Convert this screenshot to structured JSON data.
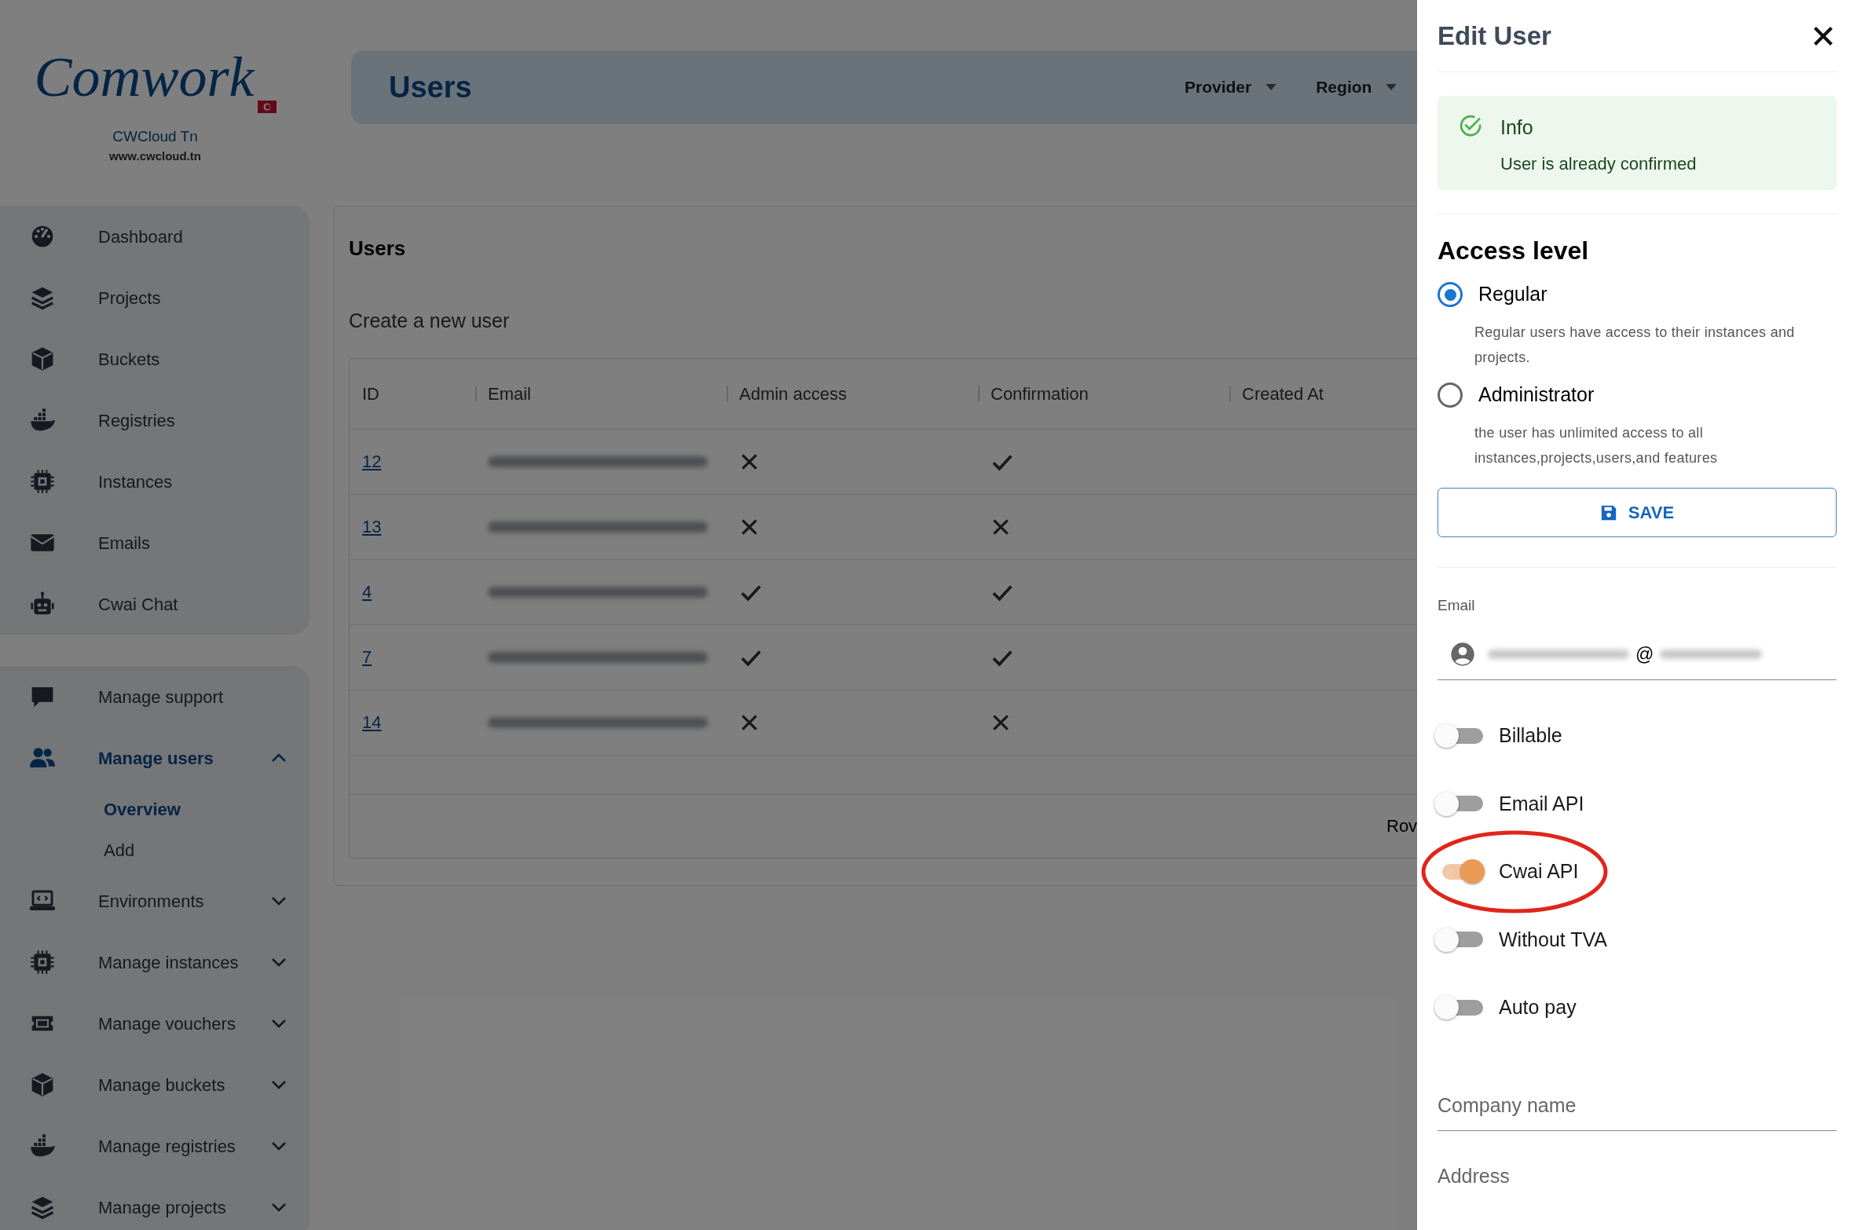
{
  "brand": {
    "logo": "Comwork",
    "name": "CWCloud Tn",
    "url": "www.cwcloud.tn"
  },
  "sidebar": {
    "groups": [
      {
        "items": [
          {
            "label": "Dashboard",
            "selected": false
          },
          {
            "label": "Projects",
            "selected": false
          },
          {
            "label": "Buckets",
            "selected": false
          },
          {
            "label": "Registries",
            "selected": false
          },
          {
            "label": "Instances",
            "selected": false
          },
          {
            "label": "Emails",
            "selected": false
          },
          {
            "label": "Cwai Chat",
            "selected": false
          }
        ]
      },
      {
        "items": [
          {
            "label": "Manage support",
            "selected": false
          },
          {
            "label": "Manage users",
            "selected": true,
            "expanded": true,
            "children": [
              {
                "label": "Overview",
                "selected": true
              },
              {
                "label": "Add",
                "selected": false
              }
            ]
          },
          {
            "label": "Environments",
            "selected": false,
            "expanded": false
          },
          {
            "label": "Manage instances",
            "selected": false,
            "expanded": false
          },
          {
            "label": "Manage vouchers",
            "selected": false,
            "expanded": false
          },
          {
            "label": "Manage buckets",
            "selected": false,
            "expanded": false
          },
          {
            "label": "Manage registries",
            "selected": false,
            "expanded": false
          },
          {
            "label": "Manage projects",
            "selected": false,
            "expanded": false
          }
        ]
      }
    ]
  },
  "header": {
    "title": "Users",
    "filters": [
      "Provider",
      "Region"
    ]
  },
  "card": {
    "title": "Users",
    "subtitle": "Create a new user",
    "table": {
      "columns": [
        "ID",
        "Email",
        "Admin access",
        "Confirmation",
        "Created At"
      ],
      "rows": [
        {
          "id": "12",
          "admin": false,
          "confirmed": true
        },
        {
          "id": "13",
          "admin": false,
          "confirmed": false
        },
        {
          "id": "4",
          "admin": true,
          "confirmed": true
        },
        {
          "id": "7",
          "admin": true,
          "confirmed": true
        },
        {
          "id": "14",
          "admin": false,
          "confirmed": false
        }
      ],
      "footer": "Rov"
    }
  },
  "drawer": {
    "title": "Edit User",
    "alert": {
      "title": "Info",
      "message": "User is already confirmed"
    },
    "access_heading": "Access level",
    "access_options": [
      {
        "label": "Regular",
        "description": "Regular users have access to their instances and projects.",
        "selected": true
      },
      {
        "label": "Administrator",
        "description": "the user has unlimited access to all instances,projects,users,and features",
        "selected": false
      }
    ],
    "save_button": "SAVE",
    "email": {
      "label": "Email",
      "value": "@"
    },
    "toggles": [
      {
        "label": "Billable",
        "on": false
      },
      {
        "label": "Email API",
        "on": false
      },
      {
        "label": "Cwai API",
        "on": true
      },
      {
        "label": "Without TVA",
        "on": false
      },
      {
        "label": "Auto pay",
        "on": false
      }
    ],
    "fields": [
      {
        "placeholder": "Company name"
      },
      {
        "placeholder": "Address"
      }
    ]
  },
  "annotation": {
    "kind": "ellipse",
    "color": "#e0251b"
  }
}
